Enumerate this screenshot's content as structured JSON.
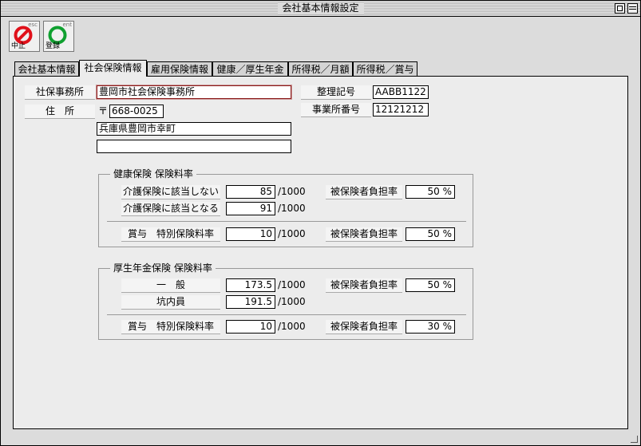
{
  "window": {
    "title": "会社基本情報設定"
  },
  "toolbar": {
    "cancel": {
      "key": "esc",
      "label": "中止"
    },
    "save": {
      "key": "ent",
      "label": "登録"
    }
  },
  "tabs": [
    "会社基本情報",
    "社会保険情報",
    "雇用保険情報",
    "健康／厚生年金",
    "所得税／月額",
    "所得税／賞与"
  ],
  "office": {
    "office_label": "社保事務所",
    "office_value": "豊岡市社会保険事務所",
    "address_label": "住　所",
    "postal_mark": "〒",
    "postal_code": "668-0025",
    "address1": "兵庫県豊岡市幸町",
    "address2": "",
    "ref_label": "整理記号",
    "ref_value": "AABB1122",
    "biz_label": "事業所番号",
    "biz_value": "12121212"
  },
  "health": {
    "title": "健康保険 保険料率",
    "row1_label": "介護保険に該当しない",
    "row1_value": "85",
    "row1_unit": "/1000",
    "row1_burden_label": "被保険者負担率",
    "row1_burden_value": "50",
    "row1_pct": "%",
    "row2_label": "介護保険に該当となる",
    "row2_value": "91",
    "row2_unit": "/1000",
    "bonus_label": "賞与　特別保険料率",
    "bonus_value": "10",
    "bonus_unit": "/1000",
    "bonus_burden_label": "被保険者負担率",
    "bonus_burden_value": "50",
    "bonus_pct": "%"
  },
  "pension": {
    "title": "厚生年金保険 保険料率",
    "row1_label": "一　般",
    "row1_value": "173.5",
    "row1_unit": "/1000",
    "row1_burden_label": "被保険者負担率",
    "row1_burden_value": "50",
    "row1_pct": "%",
    "row2_label": "坑内員",
    "row2_value": "191.5",
    "row2_unit": "/1000",
    "bonus_label": "賞与　特別保険料率",
    "bonus_value": "10",
    "bonus_unit": "/1000",
    "bonus_burden_label": "被保険者負担率",
    "bonus_burden_value": "30",
    "bonus_pct": "%"
  }
}
